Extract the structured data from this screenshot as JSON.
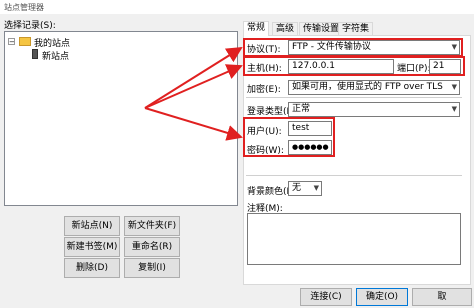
{
  "window": {
    "title": "站点管理器"
  },
  "left": {
    "select_label": "选择记录(S):",
    "tree": {
      "root": "我的站点",
      "child": "新站点"
    },
    "buttons": {
      "new_site": "新站点(N)",
      "new_folder": "新文件夹(F)",
      "new_bookmark": "新建书签(M)",
      "rename": "重命名(R)",
      "delete": "删除(D)",
      "copy": "复制(I)"
    }
  },
  "tabs": [
    "常规",
    "高级",
    "传输设置",
    "字符集"
  ],
  "general": {
    "protocol_label": "协议(T):",
    "protocol_value": "FTP - 文件传输协议",
    "host_label": "主机(H):",
    "host_value": "127.0.0.1",
    "port_label": "端口(P):",
    "port_value": "21",
    "encryption_label": "加密(E):",
    "encryption_value": "如果可用，使用显式的 FTP over TLS",
    "logon_label": "登录类型(L):",
    "logon_value": "正常",
    "user_label": "用户(U):",
    "user_value": "test",
    "password_label": "密码(W):",
    "password_value": "●●●●●●",
    "bgcolor_label": "背景颜色(B)",
    "bgcolor_value": "无",
    "comments_label": "注释(M):"
  },
  "footer": {
    "connect": "连接(C)",
    "ok": "确定(O)",
    "cancel": "取"
  },
  "colors": {
    "highlight": "#e02020",
    "folder": "#f5c542"
  }
}
